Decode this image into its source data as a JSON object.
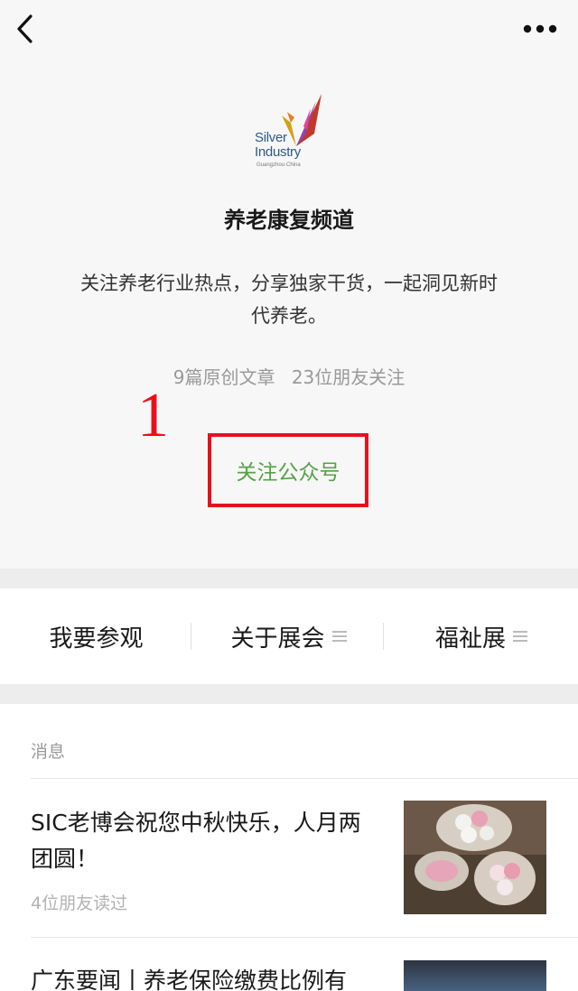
{
  "nav": {
    "back_icon": "chevron-left-icon",
    "more_icon": "more-dots-icon"
  },
  "profile": {
    "logo_line1": "Silver",
    "logo_line2": "Industry",
    "logo_line3": "Guangzhou·China",
    "name": "养老康复频道",
    "description": "关注养老行业热点，分享独家干货，一起洞见新时代养老。",
    "original_articles": "9篇原创文章",
    "followers": "23位朋友关注",
    "annotation_number": "1",
    "follow_label": "关注公众号"
  },
  "menu": {
    "items": [
      {
        "label": "我要参观",
        "has_submenu": false
      },
      {
        "label": "关于展会",
        "has_submenu": true
      },
      {
        "label": "福祉展",
        "has_submenu": true
      }
    ]
  },
  "messages": {
    "section_title": "消息",
    "articles": [
      {
        "title": "SIC老博会祝您中秋快乐，人月两团圆！",
        "meta": "4位朋友读过"
      },
      {
        "title": "广东要闻丨养老保险缴费比例有",
        "meta": ""
      }
    ]
  },
  "colors": {
    "follow_green": "#54a345",
    "annotation_red": "#e8111a"
  }
}
